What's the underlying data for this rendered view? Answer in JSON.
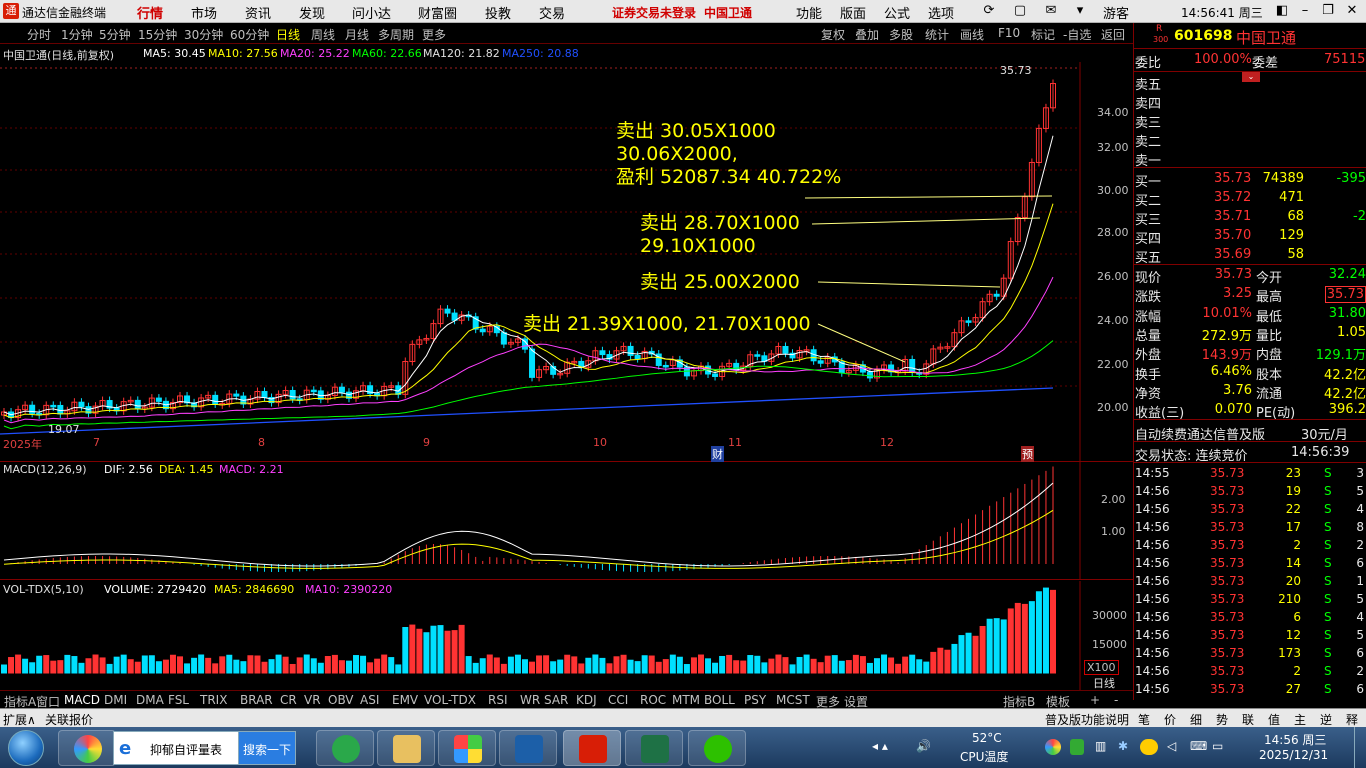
{
  "titlebar": {
    "app_name": "通达信金融终端",
    "menus": [
      "行情",
      "市场",
      "资讯",
      "发现",
      "问小达",
      "财富圈",
      "投教",
      "交易"
    ],
    "active_menu": "行情",
    "login_notice": "证券交易未登录",
    "stock_name": "中国卫通",
    "right_menus": [
      "功能",
      "版面",
      "公式",
      "选项"
    ],
    "user": "游客",
    "clock": "14:56:41 周三"
  },
  "toolbar": {
    "periods": [
      "分时",
      "1分钟",
      "5分钟",
      "15分钟",
      "30分钟",
      "60分钟",
      "日线",
      "周线",
      "月线",
      "多周期",
      "更多"
    ],
    "active_period": "日线",
    "right_buttons": [
      "复权",
      "叠加",
      "多股",
      "统计",
      "画线",
      "F10",
      "标记",
      "-自选",
      "返回"
    ]
  },
  "chart_info": {
    "title": "中国卫通(日线,前复权)",
    "ma5": "MA5: 30.45",
    "ma10": "MA10: 27.56",
    "ma20": "MA20: 25.22",
    "ma60": "MA60: 22.66",
    "ma120": "MA120: 21.82",
    "ma250": "MA250: 20.88"
  },
  "price_axis": [
    "34.00",
    "32.00",
    "30.00",
    "28.00",
    "26.00",
    "24.00",
    "22.00",
    "20.00"
  ],
  "high_label": "35.73",
  "low_label": "19.07",
  "date_labels": [
    "2025年",
    "7",
    "8",
    "9",
    "10",
    "11",
    "12"
  ],
  "markers": {
    "finance": "财",
    "report": "预"
  },
  "annotations": {
    "a1_line1": "卖出 30.05X1000",
    "a1_line2": "30.06X2000,",
    "a1_line3": "盈利 52087.34 40.722%",
    "a2_line1": "卖出 28.70X1000",
    "a2_line2": "29.10X1000",
    "a3": "卖出 25.00X2000",
    "a4": "卖出 21.39X1000, 21.70X1000"
  },
  "macd": {
    "label": "MACD(12,26,9)",
    "dif": "DIF: 2.56",
    "dea": "DEA: 1.45",
    "macd": "MACD: 2.21",
    "axis": [
      "2.00",
      "1.00"
    ]
  },
  "vol": {
    "label": "VOL-TDX(5,10)",
    "volume": "VOLUME: 2729420",
    "ma5": "MA5: 2846690",
    "ma10": "MA10: 2390220",
    "axis": [
      "30000",
      "15000"
    ],
    "unit": "X100"
  },
  "right_panel": {
    "code": "601698",
    "name": "中国卫通",
    "r_badge": "R",
    "r_num": "300",
    "weibi_label": "委比",
    "weibi": "100.00%",
    "weicha_label": "委差",
    "weicha": "75115",
    "sells": [
      "卖五",
      "卖四",
      "卖三",
      "卖二",
      "卖一"
    ],
    "buys": [
      {
        "label": "买一",
        "price": "35.73",
        "vol": "74389",
        "chg": "-395"
      },
      {
        "label": "买二",
        "price": "35.72",
        "vol": "471",
        "chg": ""
      },
      {
        "label": "买三",
        "price": "35.71",
        "vol": "68",
        "chg": "-2"
      },
      {
        "label": "买四",
        "price": "35.70",
        "vol": "129",
        "chg": ""
      },
      {
        "label": "买五",
        "price": "35.69",
        "vol": "58",
        "chg": ""
      }
    ],
    "stats": [
      {
        "l1": "现价",
        "v1": "35.73",
        "l2": "今开",
        "v2": "32.24"
      },
      {
        "l1": "涨跌",
        "v1": "3.25",
        "l2": "最高",
        "v2": "35.73"
      },
      {
        "l1": "涨幅",
        "v1": "10.01%",
        "l2": "最低",
        "v2": "31.80"
      },
      {
        "l1": "总量",
        "v1": "272.9万",
        "l2": "量比",
        "v2": "1.05"
      },
      {
        "l1": "外盘",
        "v1": "143.9万",
        "l2": "内盘",
        "v2": "129.1万"
      },
      {
        "l1": "换手",
        "v1": "6.46%",
        "l2": "股本",
        "v2": "42.2亿"
      },
      {
        "l1": "净资",
        "v1": "3.76",
        "l2": "流通",
        "v2": "42.2亿"
      },
      {
        "l1": "收益(三)",
        "v1": "0.070",
        "l2": "PE(动)",
        "v2": "396.2"
      }
    ],
    "promo": "自动续费通达信普及版",
    "promo_price": "30元/月",
    "trade_status_label": "交易状态: 连续竞价",
    "trade_status_time": "14:56:39",
    "ticks": [
      {
        "t": "14:55",
        "p": "35.73",
        "v": "23",
        "d": "S",
        "n": "3"
      },
      {
        "t": "14:56",
        "p": "35.73",
        "v": "19",
        "d": "S",
        "n": "5"
      },
      {
        "t": "14:56",
        "p": "35.73",
        "v": "22",
        "d": "S",
        "n": "4"
      },
      {
        "t": "14:56",
        "p": "35.73",
        "v": "17",
        "d": "S",
        "n": "8"
      },
      {
        "t": "14:56",
        "p": "35.73",
        "v": "2",
        "d": "S",
        "n": "2"
      },
      {
        "t": "14:56",
        "p": "35.73",
        "v": "14",
        "d": "S",
        "n": "6"
      },
      {
        "t": "14:56",
        "p": "35.73",
        "v": "20",
        "d": "S",
        "n": "1"
      },
      {
        "t": "14:56",
        "p": "35.73",
        "v": "210",
        "d": "S",
        "n": "5"
      },
      {
        "t": "14:56",
        "p": "35.73",
        "v": "6",
        "d": "S",
        "n": "4"
      },
      {
        "t": "14:56",
        "p": "35.73",
        "v": "12",
        "d": "S",
        "n": "5"
      },
      {
        "t": "14:56",
        "p": "35.73",
        "v": "173",
        "d": "S",
        "n": "6"
      },
      {
        "t": "14:56",
        "p": "35.73",
        "v": "2",
        "d": "S",
        "n": "2"
      },
      {
        "t": "14:56",
        "p": "35.73",
        "v": "27",
        "d": "S",
        "n": "6"
      }
    ],
    "bottom_tabs": [
      "笔",
      "价",
      "细",
      "势",
      "联",
      "值",
      "主",
      "逆",
      "释"
    ]
  },
  "indicators": [
    "指标A",
    "窗口",
    "MACD",
    "DMI",
    "DMA",
    "FSL",
    "TRIX",
    "BRAR",
    "CR",
    "VR",
    "OBV",
    "ASI",
    "EMV",
    "VOL-TDX",
    "RSI",
    "WR",
    "SAR",
    "KDJ",
    "CCI",
    "ROC",
    "MTM",
    "BOLL",
    "PSY",
    "MCST",
    "更多",
    "设置"
  ],
  "indicator_right": [
    "指标B",
    "模板",
    "+",
    "-"
  ],
  "period_tag": "日线",
  "statusbar": {
    "left1": "扩展∧",
    "left2": "关联报价",
    "right": "普及版功能说明"
  },
  "taskbar": {
    "task_title": "抑郁自评量表",
    "search_btn": "搜索一下",
    "temp": "52°C",
    "temp_label": "CPU温度",
    "time": "14:56 周三",
    "date": "2025/12/31"
  }
}
